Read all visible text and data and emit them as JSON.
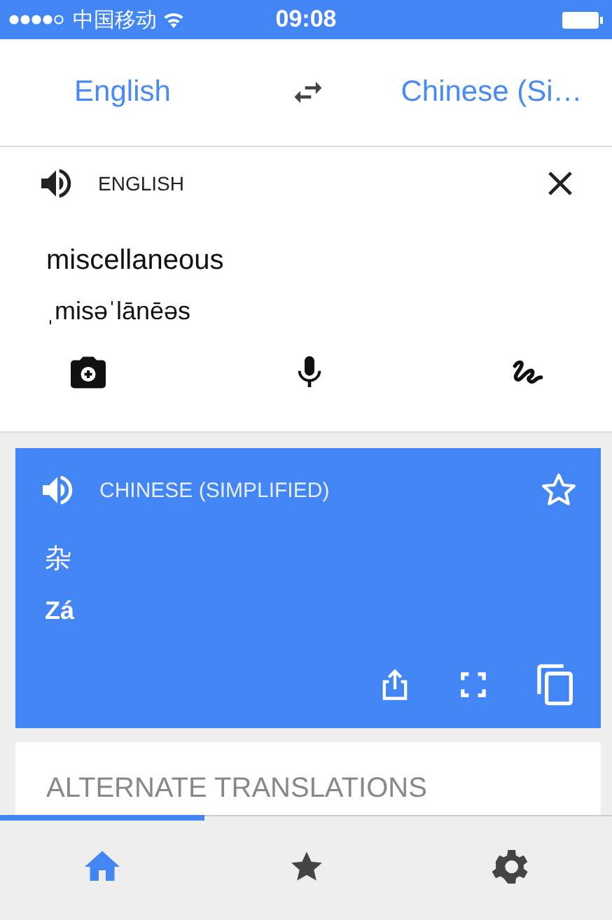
{
  "status_bar": {
    "carrier": "中国移动",
    "time": "09:08"
  },
  "language_bar": {
    "source": "English",
    "target": "Chinese (Si…"
  },
  "input": {
    "language": "ENGLISH",
    "text": "miscellaneous",
    "phonetic": "ˌmisəˈlānēəs"
  },
  "result": {
    "language": "CHINESE (SIMPLIFIED)",
    "saved": false,
    "translation": "杂",
    "romanization": "Zá"
  },
  "alternate_translations": {
    "title": "ALTERNATE TRANSLATIONS"
  },
  "bottom_nav": [
    {
      "kind": "home",
      "selected": true
    },
    {
      "kind": "favorites",
      "selected": false
    },
    {
      "kind": "settings",
      "selected": false
    }
  ]
}
